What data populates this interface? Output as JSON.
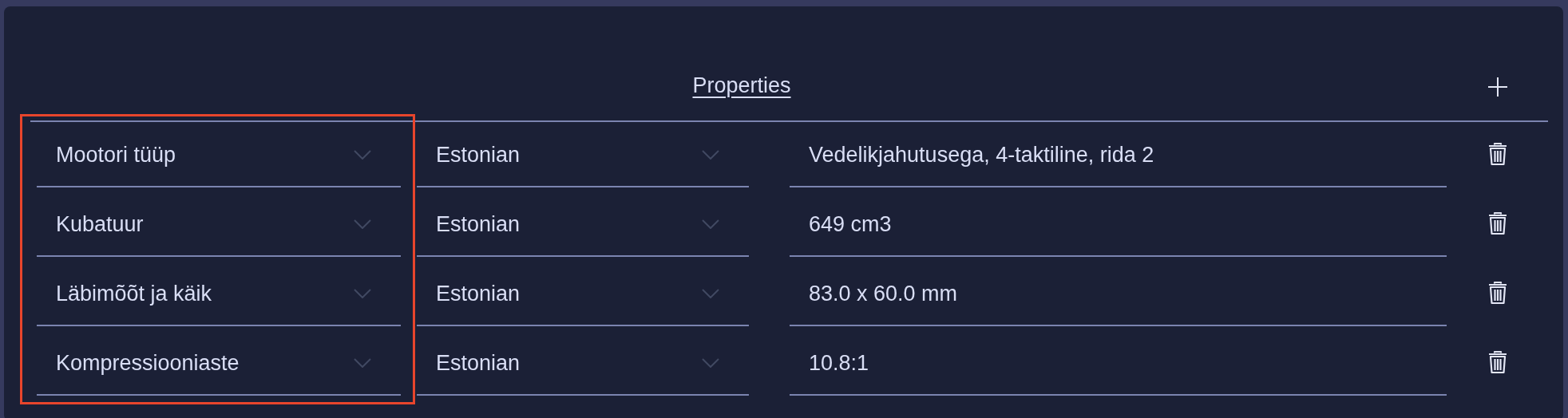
{
  "header": {
    "title": "Properties"
  },
  "rows": [
    {
      "property": "Mootori tüüp",
      "language": "Estonian",
      "value": "Vedelikjahutusega, 4-taktiline, rida 2"
    },
    {
      "property": "Kubatuur",
      "language": "Estonian",
      "value": "649 cm3"
    },
    {
      "property": "Läbimõõt ja käik",
      "language": "Estonian",
      "value": "83.0 x 60.0 mm"
    },
    {
      "property": "Kompressiooniaste",
      "language": "Estonian",
      "value": "10.8:1"
    }
  ],
  "highlight_property_column": true
}
